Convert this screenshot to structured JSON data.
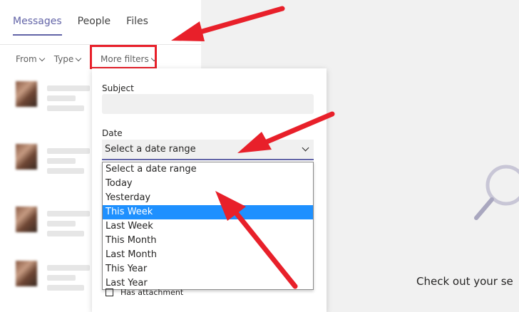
{
  "tabs": [
    {
      "label": "Messages"
    },
    {
      "label": "People"
    },
    {
      "label": "Files"
    }
  ],
  "filters": {
    "from": "From",
    "type": "Type",
    "more": "More filters"
  },
  "panel": {
    "subject_label": "Subject",
    "subject_value": "",
    "date_label": "Date",
    "date_selected": "Select a date range",
    "date_options": [
      "Select a date range",
      "Today",
      "Yesterday",
      "This Week",
      "Last Week",
      "This Month",
      "Last Month",
      "This Year",
      "Last Year"
    ],
    "highlighted_option": "This Week",
    "attachment_label": "Has attachment"
  },
  "empty_state": {
    "text": "Check out your se"
  },
  "colors": {
    "accent": "#6264a7",
    "annotation": "#e8202a",
    "selection": "#1e90ff"
  }
}
